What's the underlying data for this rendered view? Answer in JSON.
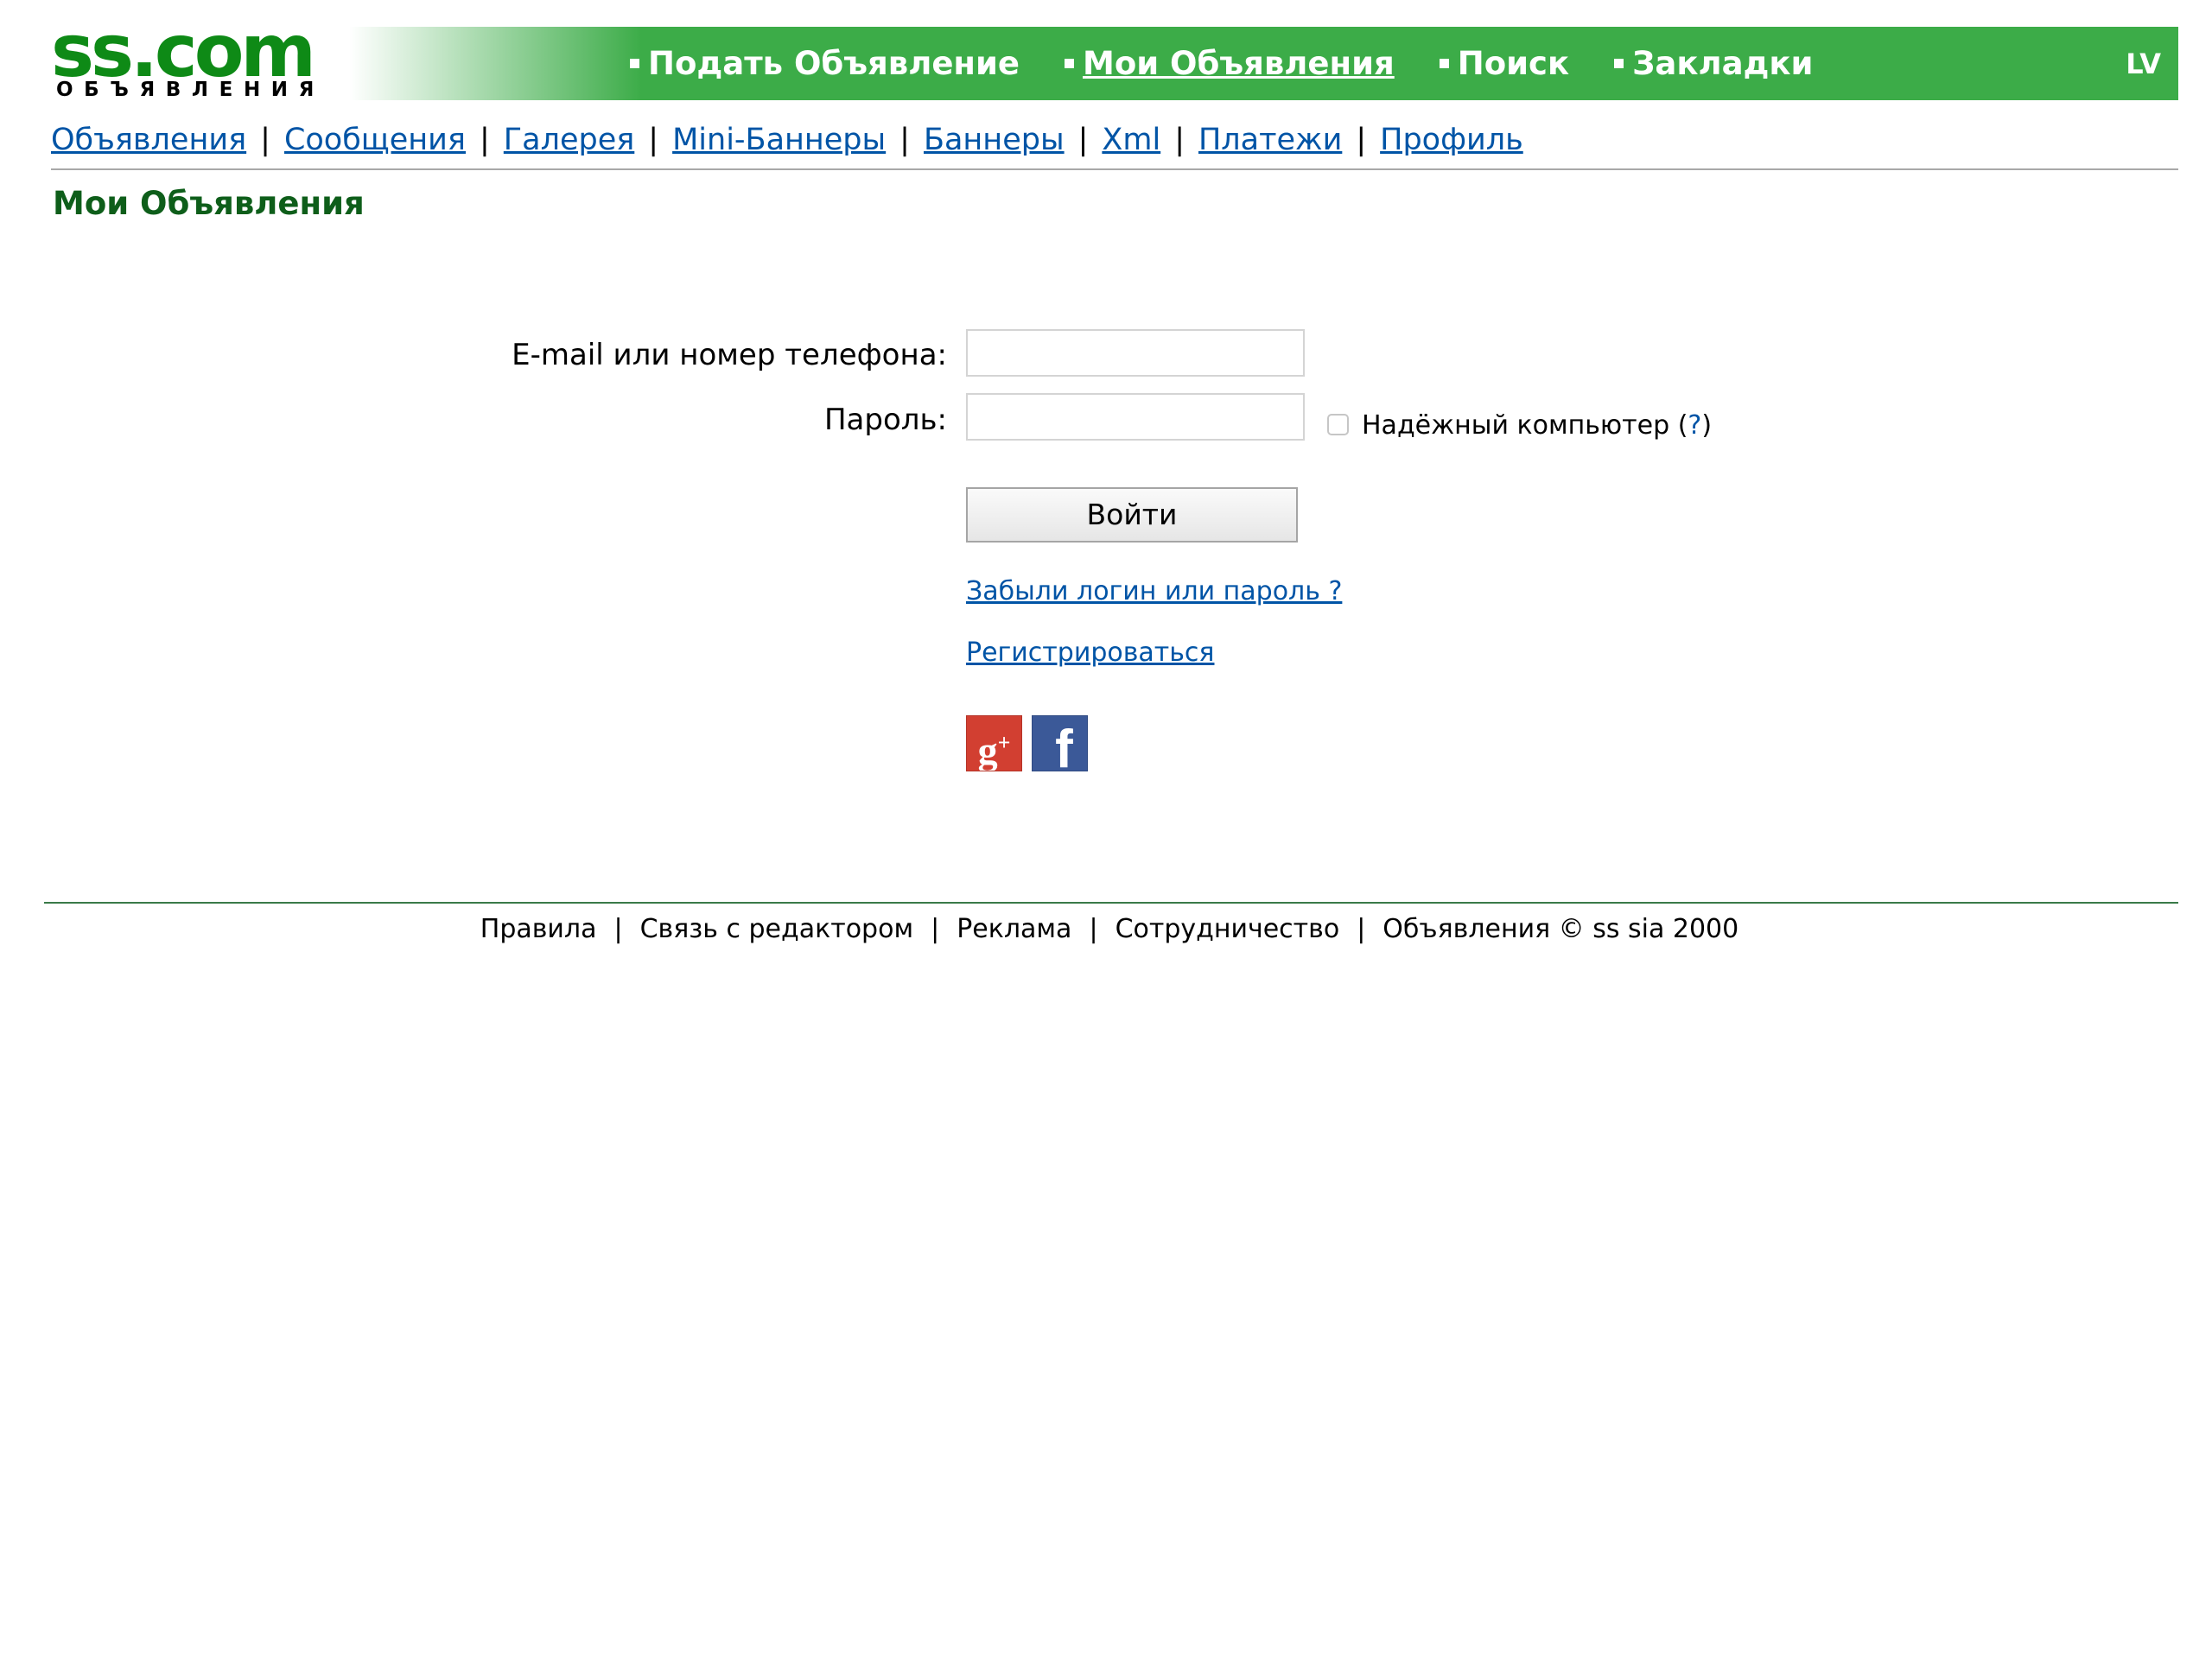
{
  "logo": {
    "main": "ss.com",
    "sub": "ОБЪЯВЛЕНИЯ"
  },
  "header": {
    "nav": [
      {
        "label": "Подать Объявление",
        "active": false
      },
      {
        "label": "Мои Объявления",
        "active": true
      },
      {
        "label": "Поиск",
        "active": false
      },
      {
        "label": "Закладки",
        "active": false
      }
    ],
    "lang": "LV"
  },
  "subnav": [
    "Объявления",
    "Сообщения",
    "Галерея",
    "Mini-Баннеры",
    "Баннеры",
    "Xml",
    "Платежи",
    "Профиль"
  ],
  "subnav_separator": "|",
  "page_title": "Мои Объявления",
  "login": {
    "email_label": "E-mail или номер телефона:",
    "email_value": "",
    "password_label": "Пароль:",
    "password_value": "",
    "trusted_label": "Надёжный компьютер",
    "trusted_open": "(",
    "trusted_help": "?",
    "trusted_close": ")",
    "trusted_checked": false,
    "submit_label": "Войти",
    "forgot_link": "Забыли логин или пароль ?",
    "register_link": "Регистрироваться"
  },
  "social": [
    {
      "name": "google-plus-icon",
      "glyph": "g",
      "sup": "+",
      "color": "#d23f31"
    },
    {
      "name": "facebook-icon",
      "glyph": "f",
      "color": "#3b5998"
    }
  ],
  "footer": {
    "items": [
      "Правила",
      "Связь с редактором",
      "Реклама",
      "Сотрудничество",
      "Объявления © ss sia 2000"
    ],
    "separator": "|"
  },
  "colors": {
    "header_green": "#3cac48",
    "logo_green": "#0e8a16",
    "title_green": "#0e5e1a",
    "link_blue": "#0054a6",
    "footer_rule": "#3a7a48"
  }
}
